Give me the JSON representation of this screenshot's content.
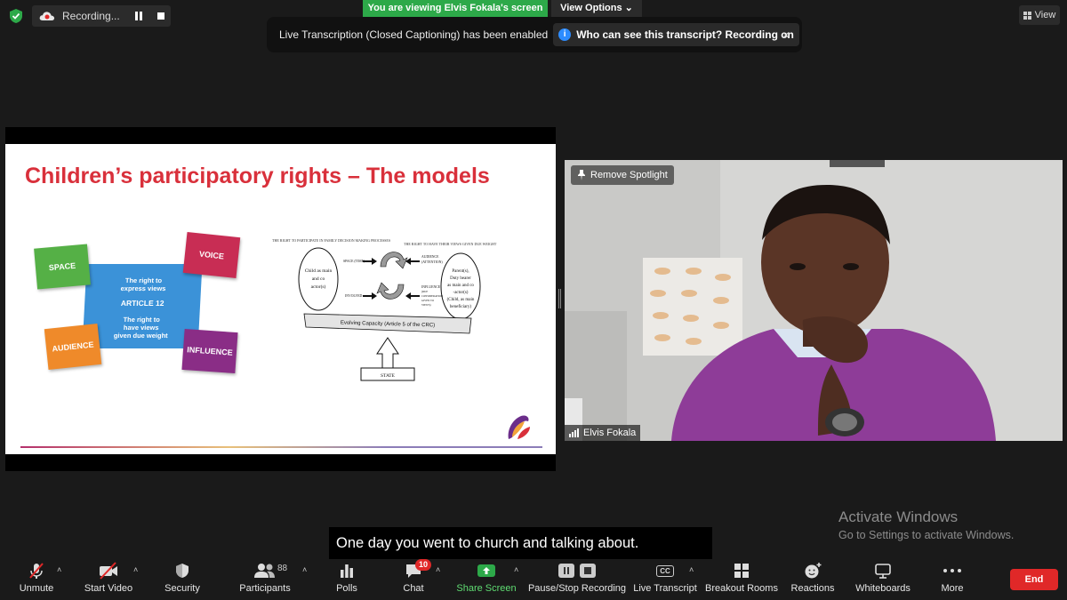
{
  "top": {
    "recording_label": "Recording...",
    "view_banner": "You are viewing Elvis Fokala's screen",
    "view_options": "View Options",
    "view_button": "View"
  },
  "notification": {
    "message": "Live Transcription (Closed Captioning) has been enabled",
    "who_button": "Who can see this transcript? Recording on",
    "close": "×"
  },
  "slide": {
    "title": "Children’s participatory rights – The models",
    "article12": {
      "space": "SPACE",
      "voice": "VOICE",
      "audience": "AUDIENCE",
      "influence": "INFLUENCE",
      "line1": "The right to",
      "line2": "express views",
      "article": "ARTICLE 12",
      "line3": "The right to",
      "line4": "have views",
      "line5": "given due weight"
    },
    "diagram": {
      "left_header": "THE RIGHT TO PARTICIPATE IN FAMILY DECISION MAKING PROCESSES",
      "right_header": "THE RIGHT TO HAVE THEIR VIEWS GIVEN DUE WEIGHT",
      "child_1": "Child as main",
      "child_2": "and co",
      "child_3": "actor(s)",
      "space": "SPACE (TIME)",
      "involved": "INVOLVED",
      "audience_1": "AUDIENCE",
      "audience_2": "(ATTENTION)",
      "influence_1": "INFLUENCE",
      "influence_2": "(DUE",
      "influence_3": "CONSIDERATION",
      "influence_4": "GIVEN TO",
      "influence_5": "VIEWS)",
      "parent_1": "Parent(s),",
      "parent_2": "Duty bearer",
      "parent_3": "as main and co",
      "parent_4": "-actor(s)",
      "parent_5": "(Child, as main",
      "parent_6": "beneficiary)",
      "beam": "Evolving Capacity (Article 5 of the CRC)",
      "state": "STATE"
    }
  },
  "video": {
    "remove_spotlight": "Remove Spotlight",
    "participant_name": "Elvis Fokala"
  },
  "caption": "One day you went to church and talking about.",
  "activate": {
    "title": "Activate Windows",
    "subtitle": "Go to Settings to activate Windows."
  },
  "toolbar": {
    "unmute": "Unmute",
    "start_video": "Start Video",
    "security": "Security",
    "participants": "Participants",
    "participants_count": "88",
    "polls": "Polls",
    "chat": "Chat",
    "chat_badge": "10",
    "share_screen": "Share Screen",
    "pause_stop": "Pause/Stop Recording",
    "live_transcript": "Live Transcript",
    "cc": "CC",
    "breakout": "Breakout Rooms",
    "reactions": "Reactions",
    "whiteboards": "Whiteboards",
    "more": "More",
    "end": "End"
  },
  "colors": {
    "green_banner": "#2da949",
    "end_red": "#e02828",
    "title_red": "#d9303b"
  }
}
